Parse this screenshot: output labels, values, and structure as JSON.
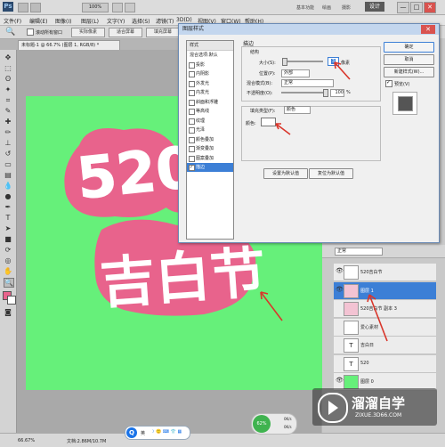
{
  "app": {
    "logo": "Ps",
    "title_items": [
      "基本功能",
      "绘画",
      "摄影"
    ],
    "design_button": "设计",
    "win_controls": [
      "—",
      "□",
      "✕"
    ]
  },
  "menu": [
    "文件(F)",
    "编辑(E)",
    "图像(I)",
    "图层(L)",
    "文字(Y)",
    "选择(S)",
    "滤镜(T)",
    "3D(D)",
    "视图(V)",
    "窗口(W)",
    "帮助(H)"
  ],
  "options": {
    "checkbox_label": "滚动所有窗口",
    "buttons": [
      "实际像素",
      "适合屏幕",
      "填充屏幕",
      "打印尺寸"
    ]
  },
  "document_tab": "未标题-1 @ 66.7% (图层 1, RGB/8) *",
  "dialog": {
    "title": "图层样式",
    "close": "✕",
    "styles_header": "样式",
    "styles": [
      {
        "label": "混合选项:默认",
        "checkbox": false,
        "selected": false
      },
      {
        "label": "投影",
        "checkbox": true,
        "selected": false
      },
      {
        "label": "内阴影",
        "checkbox": true,
        "selected": false
      },
      {
        "label": "外发光",
        "checkbox": true,
        "selected": false
      },
      {
        "label": "内发光",
        "checkbox": true,
        "selected": false
      },
      {
        "label": "斜面和浮雕",
        "checkbox": true,
        "selected": false
      },
      {
        "label": "等高线",
        "checkbox": true,
        "selected": false
      },
      {
        "label": "纹理",
        "checkbox": true,
        "selected": false
      },
      {
        "label": "光泽",
        "checkbox": true,
        "selected": false
      },
      {
        "label": "颜色叠加",
        "checkbox": true,
        "selected": false
      },
      {
        "label": "渐变叠加",
        "checkbox": true,
        "selected": false
      },
      {
        "label": "图案叠加",
        "checkbox": true,
        "selected": false
      },
      {
        "label": "描边",
        "checkbox": true,
        "selected": true
      }
    ],
    "section_title": "描边",
    "structure_title": "结构",
    "size_label": "大小(S):",
    "size_value": "3",
    "size_unit": "像素",
    "position_label": "位置(P):",
    "position_value": "外部",
    "blend_label": "混合模式(B):",
    "blend_value": "正常",
    "opacity_label": "不透明度(O):",
    "opacity_value": "100",
    "opacity_unit": "%",
    "fill_type_label": "填充类型(F):",
    "fill_type_value": "颜色",
    "color_label": "颜色:",
    "stroke_color": "#ffffff",
    "default_set_button": "设置为默认值",
    "default_reset_button": "复位为默认值",
    "ok_button": "确定",
    "cancel_button": "取消",
    "new_style_button": "新建样式(W)...",
    "preview_label": "预览(V)",
    "preview_checked": true
  },
  "layers": {
    "blend_mode": "正常",
    "items": [
      {
        "name": "520吉白节",
        "visible": true,
        "thumb": "",
        "selected": false
      },
      {
        "name": "图层 1",
        "visible": true,
        "thumb": "",
        "selected": true
      },
      {
        "name": "520吉白节 副本 3",
        "visible": false,
        "thumb": "",
        "selected": false
      },
      {
        "name": "爱心素材",
        "visible": false,
        "thumb": "",
        "selected": false
      },
      {
        "name": "吉白日",
        "visible": false,
        "thumb": "T",
        "selected": false
      },
      {
        "name": "520",
        "visible": false,
        "thumb": "T",
        "selected": false
      },
      {
        "name": "图层 0",
        "visible": true,
        "thumb": "",
        "selected": false
      }
    ]
  },
  "artwork": {
    "top_text": "520",
    "bottom_text": "吉白节",
    "pink": "#e8638c",
    "green": "#66f07a"
  },
  "statusbar": {
    "zoom": "66.67%",
    "doc": "文档:2.86M/10.7M"
  },
  "ime": {
    "label": "英"
  },
  "perf": {
    "percent": "62%",
    "up": "0K/s",
    "down": "0K/s"
  },
  "watermark": {
    "title": "溜溜自学",
    "url": "ZIXUE.3D66.COM"
  },
  "colors": {
    "accent_selected": "#3c7fd6",
    "arrow": "#d9362b"
  }
}
